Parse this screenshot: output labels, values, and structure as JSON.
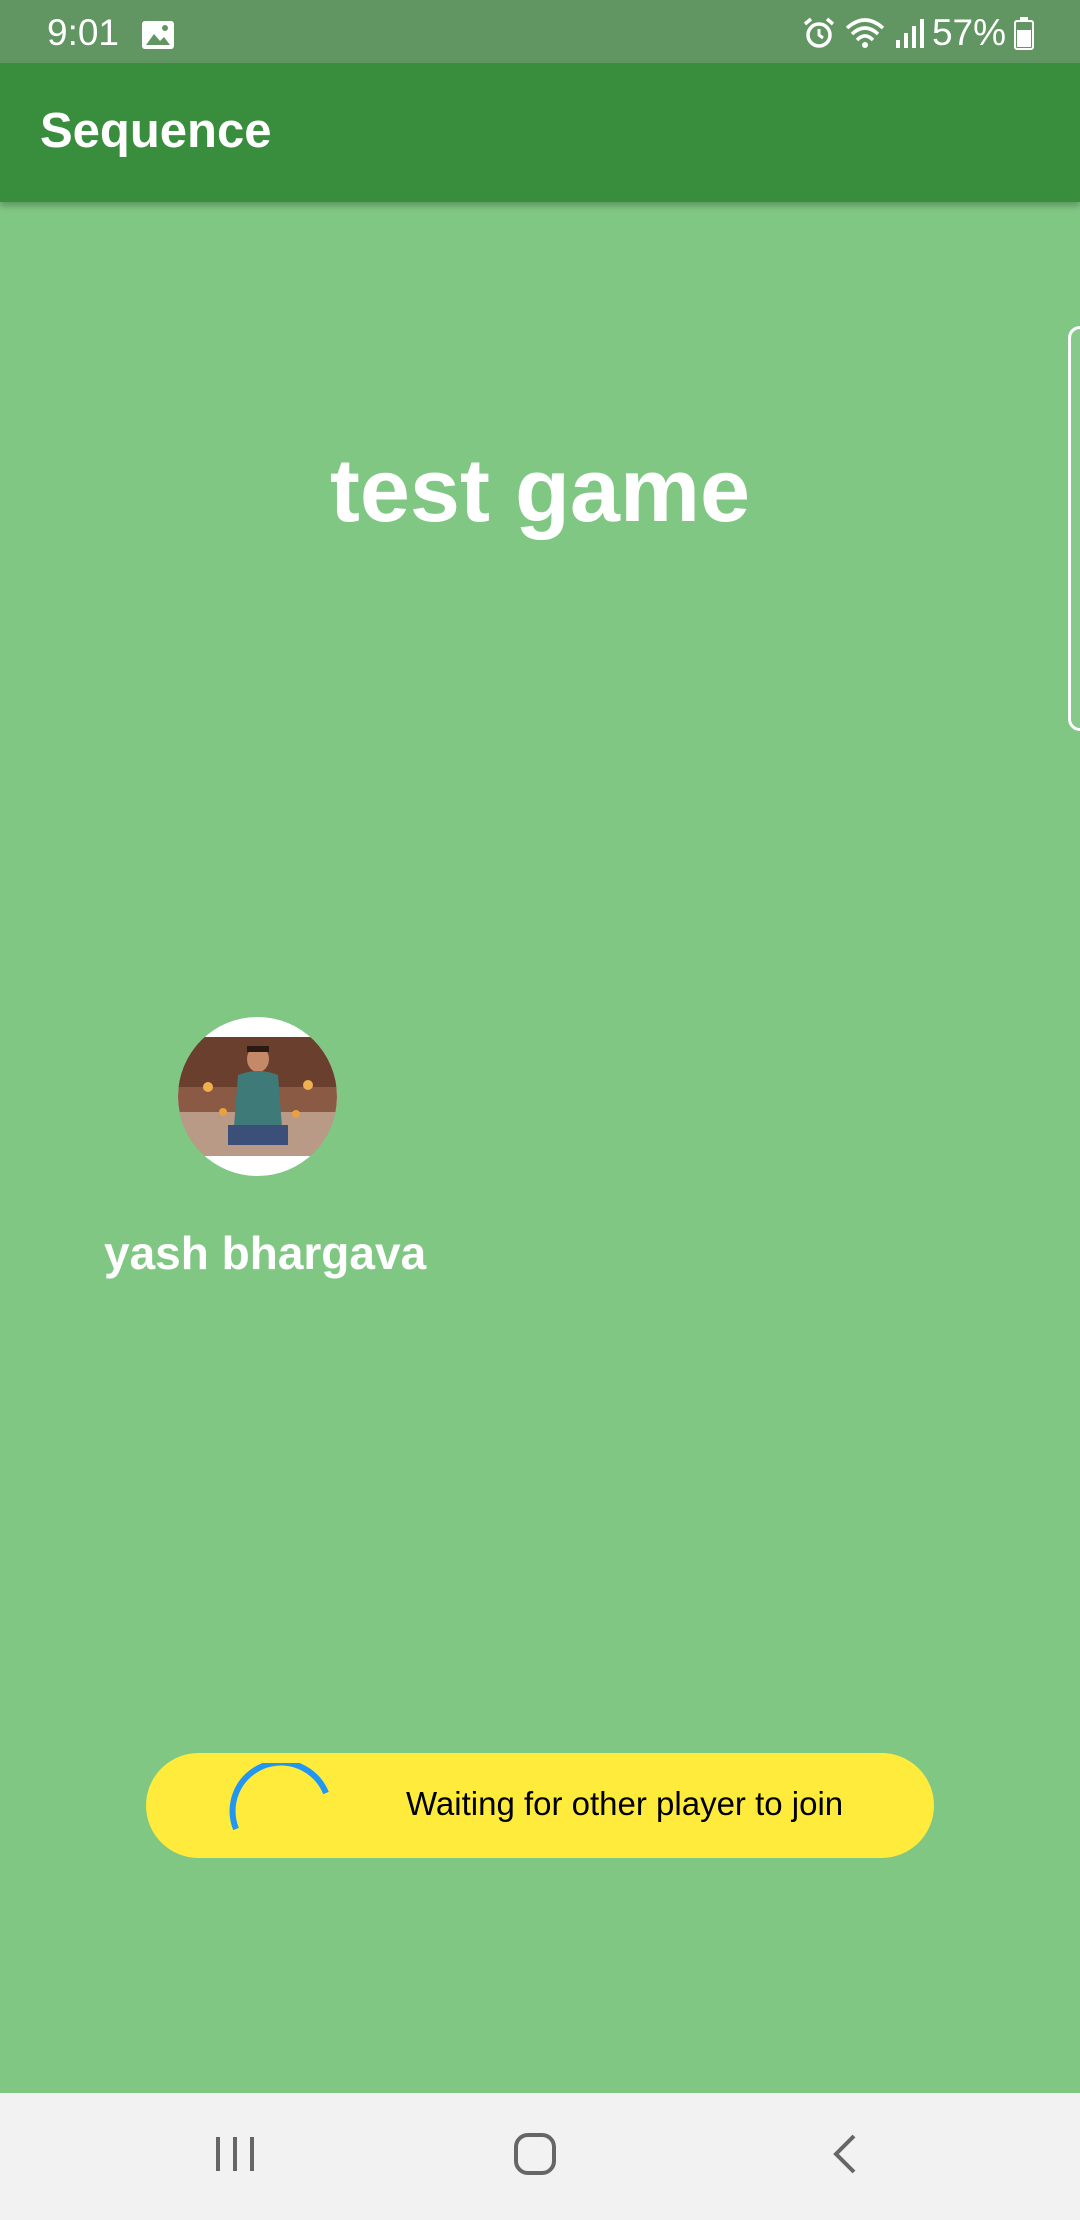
{
  "status_bar": {
    "time": "9:01",
    "battery_percent": "57%",
    "icons": [
      "gallery-icon",
      "alarm-icon",
      "wifi-icon",
      "signal-icon",
      "battery-icon"
    ]
  },
  "app_bar": {
    "title": "Sequence"
  },
  "game": {
    "title": "test game"
  },
  "player": {
    "name": "yash bhargava"
  },
  "waiting": {
    "message": "Waiting for other player to join"
  },
  "colors": {
    "background": "#81c784",
    "app_bar": "#388e3c",
    "status_bar": "#619662",
    "waiting_pill": "#ffeb3b",
    "spinner": "#2196f3",
    "nav_bar": "#f2f2f2"
  },
  "nav_bar": {
    "buttons": [
      "recents-icon",
      "home-icon",
      "back-icon"
    ]
  }
}
